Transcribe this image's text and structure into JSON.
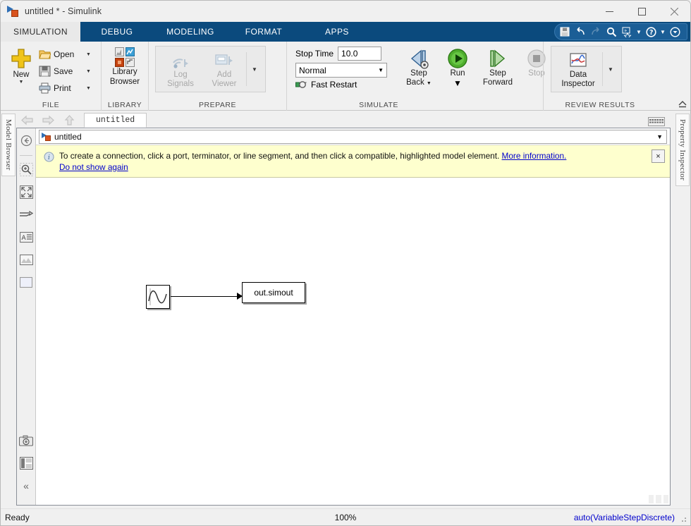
{
  "window": {
    "title": "untitled * - Simulink",
    "app_icon": "simulink-logo-icon",
    "minimize_label": "minimize-icon",
    "maximize_label": "maximize-icon",
    "close_label": "close-icon"
  },
  "ribbon": {
    "tabs": [
      {
        "label": "SIMULATION",
        "active": true
      },
      {
        "label": "DEBUG",
        "active": false
      },
      {
        "label": "MODELING",
        "active": false
      },
      {
        "label": "FORMAT",
        "active": false
      },
      {
        "label": "APPS",
        "active": false
      }
    ],
    "quick_access": [
      {
        "name": "save-icon",
        "glyph": "💾",
        "enabled": true
      },
      {
        "name": "undo-icon",
        "glyph": "↶",
        "enabled": true
      },
      {
        "name": "redo-icon",
        "glyph": "↷",
        "enabled": false
      },
      {
        "name": "search-icon",
        "glyph": "🔍",
        "enabled": true
      },
      {
        "name": "favorites-icon",
        "glyph": "»",
        "enabled": true
      },
      {
        "name": "favorites-caret-icon",
        "glyph": "▼",
        "enabled": true
      },
      {
        "name": "help-icon",
        "glyph": "?",
        "enabled": true
      },
      {
        "name": "help-caret-icon",
        "glyph": "▼",
        "enabled": true
      },
      {
        "name": "minimize-ribbon-icon",
        "glyph": "▼",
        "enabled": true
      }
    ],
    "groups": {
      "file": {
        "label": "FILE",
        "new_label": "New",
        "open_label": "Open",
        "save_label": "Save",
        "print_label": "Print"
      },
      "library": {
        "label": "LIBRARY",
        "browser_label_line1": "Library",
        "browser_label_line2": "Browser"
      },
      "prepare": {
        "label": "PREPARE",
        "log_signals_line1": "Log",
        "log_signals_line2": "Signals",
        "add_viewer_line1": "Add",
        "add_viewer_line2": "Viewer",
        "more_caret": "▼"
      },
      "simulate": {
        "label": "SIMULATE",
        "stop_time_label": "Stop Time",
        "stop_time_value": "10.0",
        "mode_value": "Normal",
        "mode_caret": "▼",
        "fast_restart_label": "Fast Restart",
        "step_back_line1": "Step",
        "step_back_line2": "Back",
        "run_label": "Run",
        "step_forward_line1": "Step",
        "step_forward_line2": "Forward",
        "stop_label": "Stop"
      },
      "review": {
        "label": "REVIEW RESULTS",
        "data_inspector_line1": "Data",
        "data_inspector_line2": "Inspector",
        "caret": "▼"
      }
    }
  },
  "left_panel": {
    "label": "Model Browser"
  },
  "right_panel": {
    "label": "Property Inspector"
  },
  "editor": {
    "back_icon": "back-arrow-icon",
    "forward_icon": "forward-arrow-icon",
    "up_icon": "up-arrow-icon",
    "file_tab": "untitled",
    "address": {
      "text": "untitled",
      "caret": "▼"
    },
    "notice": {
      "icon": "info-icon",
      "text": "To create a connection, click a port, terminator, or line segment, and then click a compatible, highlighted model element.",
      "more_link": "More information.",
      "dismiss_link": "Do not show again",
      "close_label": "×"
    },
    "tools": [
      {
        "name": "navigate-back-icon"
      },
      {
        "name": "zoom-in-icon"
      },
      {
        "name": "fit-to-view-icon"
      },
      {
        "name": "signal-routing-icon"
      },
      {
        "name": "annotation-icon"
      },
      {
        "name": "image-icon"
      },
      {
        "name": "area-icon"
      }
    ],
    "bottom_tools": [
      {
        "name": "camera-snapshot-icon"
      },
      {
        "name": "layout-panels-icon"
      },
      {
        "name": "collapse-toolbar-icon",
        "glyph": "«"
      }
    ]
  },
  "diagram": {
    "blocks": [
      {
        "name": "sine-wave-block",
        "label": ""
      },
      {
        "name": "to-workspace-block",
        "label": "out.simout"
      }
    ]
  },
  "statusbar": {
    "status": "Ready",
    "zoom": "100%",
    "solver": "auto(VariableStepDiscrete)"
  }
}
